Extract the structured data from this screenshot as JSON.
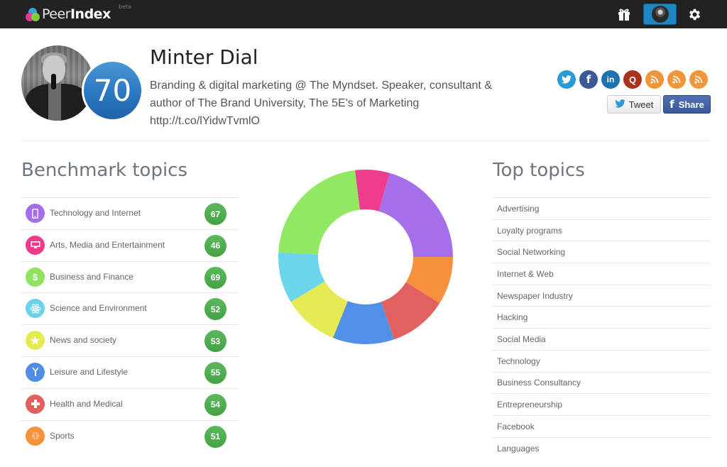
{
  "app": {
    "logo_light": "Peer",
    "logo_bold": "Index",
    "logo_badge": "beta",
    "nav_icons": [
      "gift-icon",
      "user-avatar",
      "gear-icon"
    ]
  },
  "profile": {
    "name": "Minter Dial",
    "score": "70",
    "bio_lines": [
      "Branding & digital marketing @ The Myndset. Speaker, consultant &",
      "author of The Brand University, The 5E's of Marketing",
      "http://t.co/lYidwTvmlO"
    ],
    "social_links": [
      {
        "name": "twitter",
        "icon": "twitter-icon",
        "color": "#2b9bd6"
      },
      {
        "name": "facebook",
        "icon": "facebook-icon",
        "color": "#3b5998"
      },
      {
        "name": "linkedin",
        "icon": "linkedin-icon",
        "color": "#1d72b0"
      },
      {
        "name": "quora",
        "icon": "quora-icon",
        "color": "#a8321e",
        "glyph": "Q"
      },
      {
        "name": "rss-1",
        "icon": "rss-icon",
        "color": "#f0963a"
      },
      {
        "name": "rss-2",
        "icon": "rss-icon",
        "color": "#f0963a"
      },
      {
        "name": "rss-3",
        "icon": "rss-icon",
        "color": "#f0963a"
      }
    ],
    "tweet_label": "Tweet",
    "share_label": "Share"
  },
  "benchmark": {
    "title": "Benchmark topics",
    "items": [
      {
        "label": "Technology and Internet",
        "score": "67",
        "color": "#a56ee8",
        "icon": "mobile-phone-icon"
      },
      {
        "label": "Arts, Media and Entertainment",
        "score": "46",
        "color": "#ee3a8c",
        "icon": "monitor-icon"
      },
      {
        "label": "Business and Finance",
        "score": "69",
        "color": "#8fe35f",
        "icon": "dollar-icon"
      },
      {
        "label": "Science and Environment",
        "score": "52",
        "color": "#6ad3ea",
        "icon": "atom-icon"
      },
      {
        "label": "News and society",
        "score": "53",
        "color": "#e3ea52",
        "icon": "star-icon"
      },
      {
        "label": "Leisure and Lifestyle",
        "score": "55",
        "color": "#4f8ee6",
        "icon": "cocktail-icon"
      },
      {
        "label": "Health and Medical",
        "score": "54",
        "color": "#e35f5f",
        "icon": "medical-cross-icon"
      },
      {
        "label": "Sports",
        "score": "51",
        "color": "#f59138",
        "icon": "ball-icon"
      }
    ]
  },
  "top_topics": {
    "title": "Top topics",
    "items": [
      "Advertising",
      "Loyalty programs",
      "Social Networking",
      "Internet & Web",
      "Newspaper Industry",
      "Hacking",
      "Social Media",
      "Technology",
      "Business Consultancy",
      "Entrepreneurship",
      "Facebook",
      "Languages"
    ]
  },
  "chart_data": {
    "type": "pie",
    "variant": "donut",
    "title": "",
    "start_angle_deg": -7,
    "slices": [
      {
        "label": "Arts, Media and Entertainment",
        "value": 23,
        "color": "#ef3c8d"
      },
      {
        "label": "Technology and Internet",
        "value": 74,
        "color": "#a66fea"
      },
      {
        "label": "Sports",
        "value": 32,
        "color": "#f7913e"
      },
      {
        "label": "Health and Medical",
        "value": 39,
        "color": "#e36060"
      },
      {
        "label": "Leisure and Lifestyle",
        "value": 41,
        "color": "#528fe6"
      },
      {
        "label": "News and society",
        "value": 37,
        "color": "#e5ea54"
      },
      {
        "label": "Science and Environment",
        "value": 34,
        "color": "#6cd5ec"
      },
      {
        "label": "Business and Finance",
        "value": 80,
        "color": "#90e863"
      }
    ],
    "legend": "none"
  }
}
